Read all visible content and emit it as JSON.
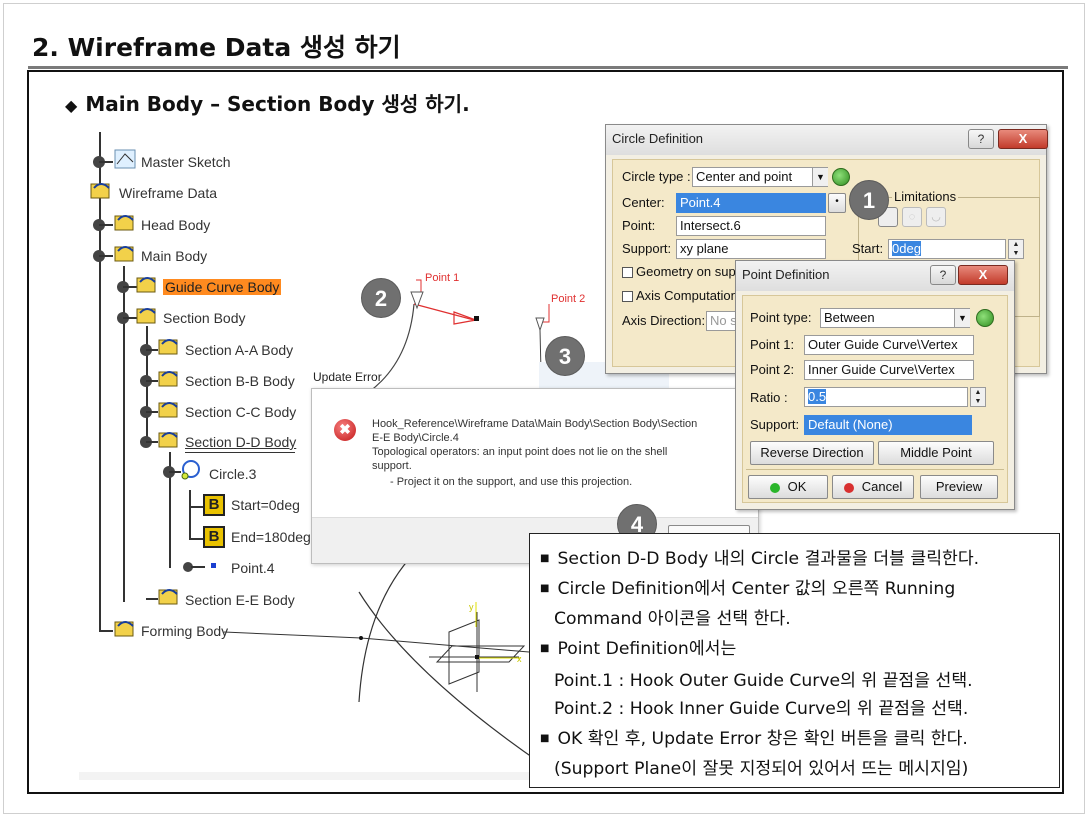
{
  "slide": {
    "title": "2. Wireframe Data 생성 하기",
    "subtitle_bullet": "◆",
    "subtitle": "Main Body – Section Body 생성 하기."
  },
  "tree": {
    "master_sketch": "Master Sketch",
    "wireframe_data": "Wireframe Data",
    "head_body": "Head Body",
    "main_body": "Main Body",
    "guide_curve_body": "Guide Curve Body",
    "section_body": "Section Body",
    "section_aa": "Section A-A Body",
    "section_bb": "Section B-B Body",
    "section_cc": "Section C-C Body",
    "section_dd": "Section D-D Body",
    "circle3": "Circle.3",
    "start": "Start=0deg",
    "end": "End=180deg",
    "point4": "Point.4",
    "section_ee": "Section E-E Body",
    "forming_body": "Forming Body"
  },
  "viewport": {
    "point1_label": "Point 1",
    "point2_label": "Point 2"
  },
  "circle_dialog": {
    "title": "Circle Definition",
    "help": "?",
    "close": "X",
    "circle_type_label": "Circle type :",
    "circle_type_value": "Center and point",
    "center_label": "Center:",
    "center_value": "Point.4",
    "point_label": "Point:",
    "point_value": "Intersect.6",
    "support_label": "Support:",
    "support_value": "xy plane",
    "geometry_label": "Geometry on sup",
    "axis_comp_label": "Axis Computation",
    "axis_dir_label": "Axis Direction:",
    "axis_dir_value": "No s",
    "limitations_label": "Limitations",
    "start_label": "Start:",
    "start_value": "0deg"
  },
  "point_dialog": {
    "title": "Point Definition",
    "help": "?",
    "close": "X",
    "type_label": "Point type:",
    "type_value": "Between",
    "p1_label": "Point 1:",
    "p1_value": "Outer Guide Curve\\Vertex",
    "p2_label": "Point 2:",
    "p2_value": "Inner Guide Curve\\Vertex",
    "ratio_label": "Ratio :",
    "ratio_value": "0.5",
    "support_label": "Support:",
    "support_value": "Default (None)",
    "reverse_btn": "Reverse Direction",
    "middle_btn": "Middle Point",
    "ok_btn": "OK",
    "cancel_btn": "Cancel",
    "preview_btn": "Preview"
  },
  "update_error": {
    "title": "Update Error",
    "icon": "✖",
    "line1": "Hook_Reference\\Wireframe Data\\Main Body\\Section Body\\Section",
    "line2": "E-E Body\\Circle.4",
    "line3": "Topological operators: an input point does not lie on the shell",
    "line4": "support.",
    "line5": "- Project it on the support, and use this projection."
  },
  "steps": [
    "1",
    "2",
    "3",
    "4"
  ],
  "instructions": {
    "bullet": "■",
    "l1": "Section D-D Body 내의 Circle 결과물을 더블 클릭한다.",
    "l2": "Circle Definition에서 Center 값의 오른쪽 Running",
    "l3": "Command 아이콘을 선택 한다.",
    "l4": "Point Definition에서는",
    "l5": "Point.1 : Hook Outer Guide Curve의 위 끝점을 선택.",
    "l6": "Point.2 : Hook Inner Guide Curve의 위 끝점을 선택.",
    "l7": "OK 확인 후, Update Error 창은 확인 버튼을 클릭 한다.",
    "l8": "(Support Plane이 잘못 지정되어 있어서 뜨는 메시지임)"
  }
}
